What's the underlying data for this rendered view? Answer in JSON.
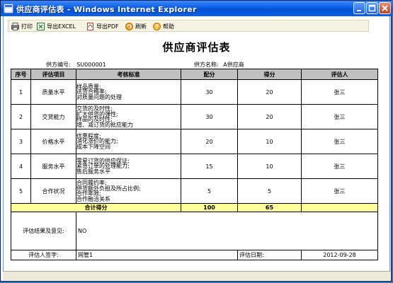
{
  "window": {
    "title": "供应商评估表 - Windows Internet Explorer",
    "controls": [
      "minimize",
      "maximize",
      "close"
    ]
  },
  "toolbar": {
    "items": [
      {
        "label": "打印",
        "icon": "printer-icon"
      },
      {
        "label": "导出EXCEL",
        "icon": "excel-icon"
      },
      {
        "label": "导出PDF",
        "icon": "pdf-icon"
      },
      {
        "label": "刷新",
        "icon": "refresh-icon"
      },
      {
        "label": "帮助",
        "icon": "help-icon"
      }
    ]
  },
  "page": {
    "title": "供应商评估表",
    "supplier_no_label": "供方编号:",
    "supplier_no": "SU000001",
    "supplier_name_label": "供方名称:",
    "supplier_name": "A供应商"
  },
  "table": {
    "headers": [
      "序号",
      "评估项目",
      "考核标准",
      "配分",
      "得分",
      "评估人"
    ],
    "rows": [
      {
        "no": "1",
        "item": "质量水平",
        "criteria": [
          "样品质量;",
          "送货合格率;",
          "对质量问题的处理"
        ],
        "max": "30",
        "score": "20",
        "assessor": "张三"
      },
      {
        "no": "2",
        "item": "交货能力",
        "criteria": [
          "交货的及时性;",
          "扩大供货的弹性;",
          "样品的及时性;",
          "增、减订货的批应能力"
        ],
        "max": "30",
        "score": "20",
        "assessor": "张三"
      },
      {
        "no": "3",
        "item": "价格水平",
        "criteria": [
          "优惠程度;",
          "消化涨价的能力;",
          "成本下降空间"
        ],
        "max": "20",
        "score": "10",
        "assessor": "张三"
      },
      {
        "no": "4",
        "item": "服务水平",
        "criteria": [
          "零星订货的供应保证;",
          "紧急订单的处理能力;",
          "售后服务水平"
        ],
        "max": "15",
        "score": "10",
        "assessor": "张三"
      },
      {
        "no": "5",
        "item": "合作状况",
        "criteria": [
          "合同履约率;",
          "供货额外负担及所占比例;",
          "合作年限;",
          "合作融洽关系"
        ],
        "max": "5",
        "score": "5",
        "assessor": "张三"
      }
    ],
    "total": {
      "label": "合计得分",
      "max": "100",
      "score": "65"
    },
    "result": {
      "label": "评估结果及意见:",
      "value": "NO"
    },
    "sign": {
      "label": "评估人签字:",
      "value": "网管1",
      "date_label": "评估日期:",
      "date": "2012-09-28"
    }
  }
}
